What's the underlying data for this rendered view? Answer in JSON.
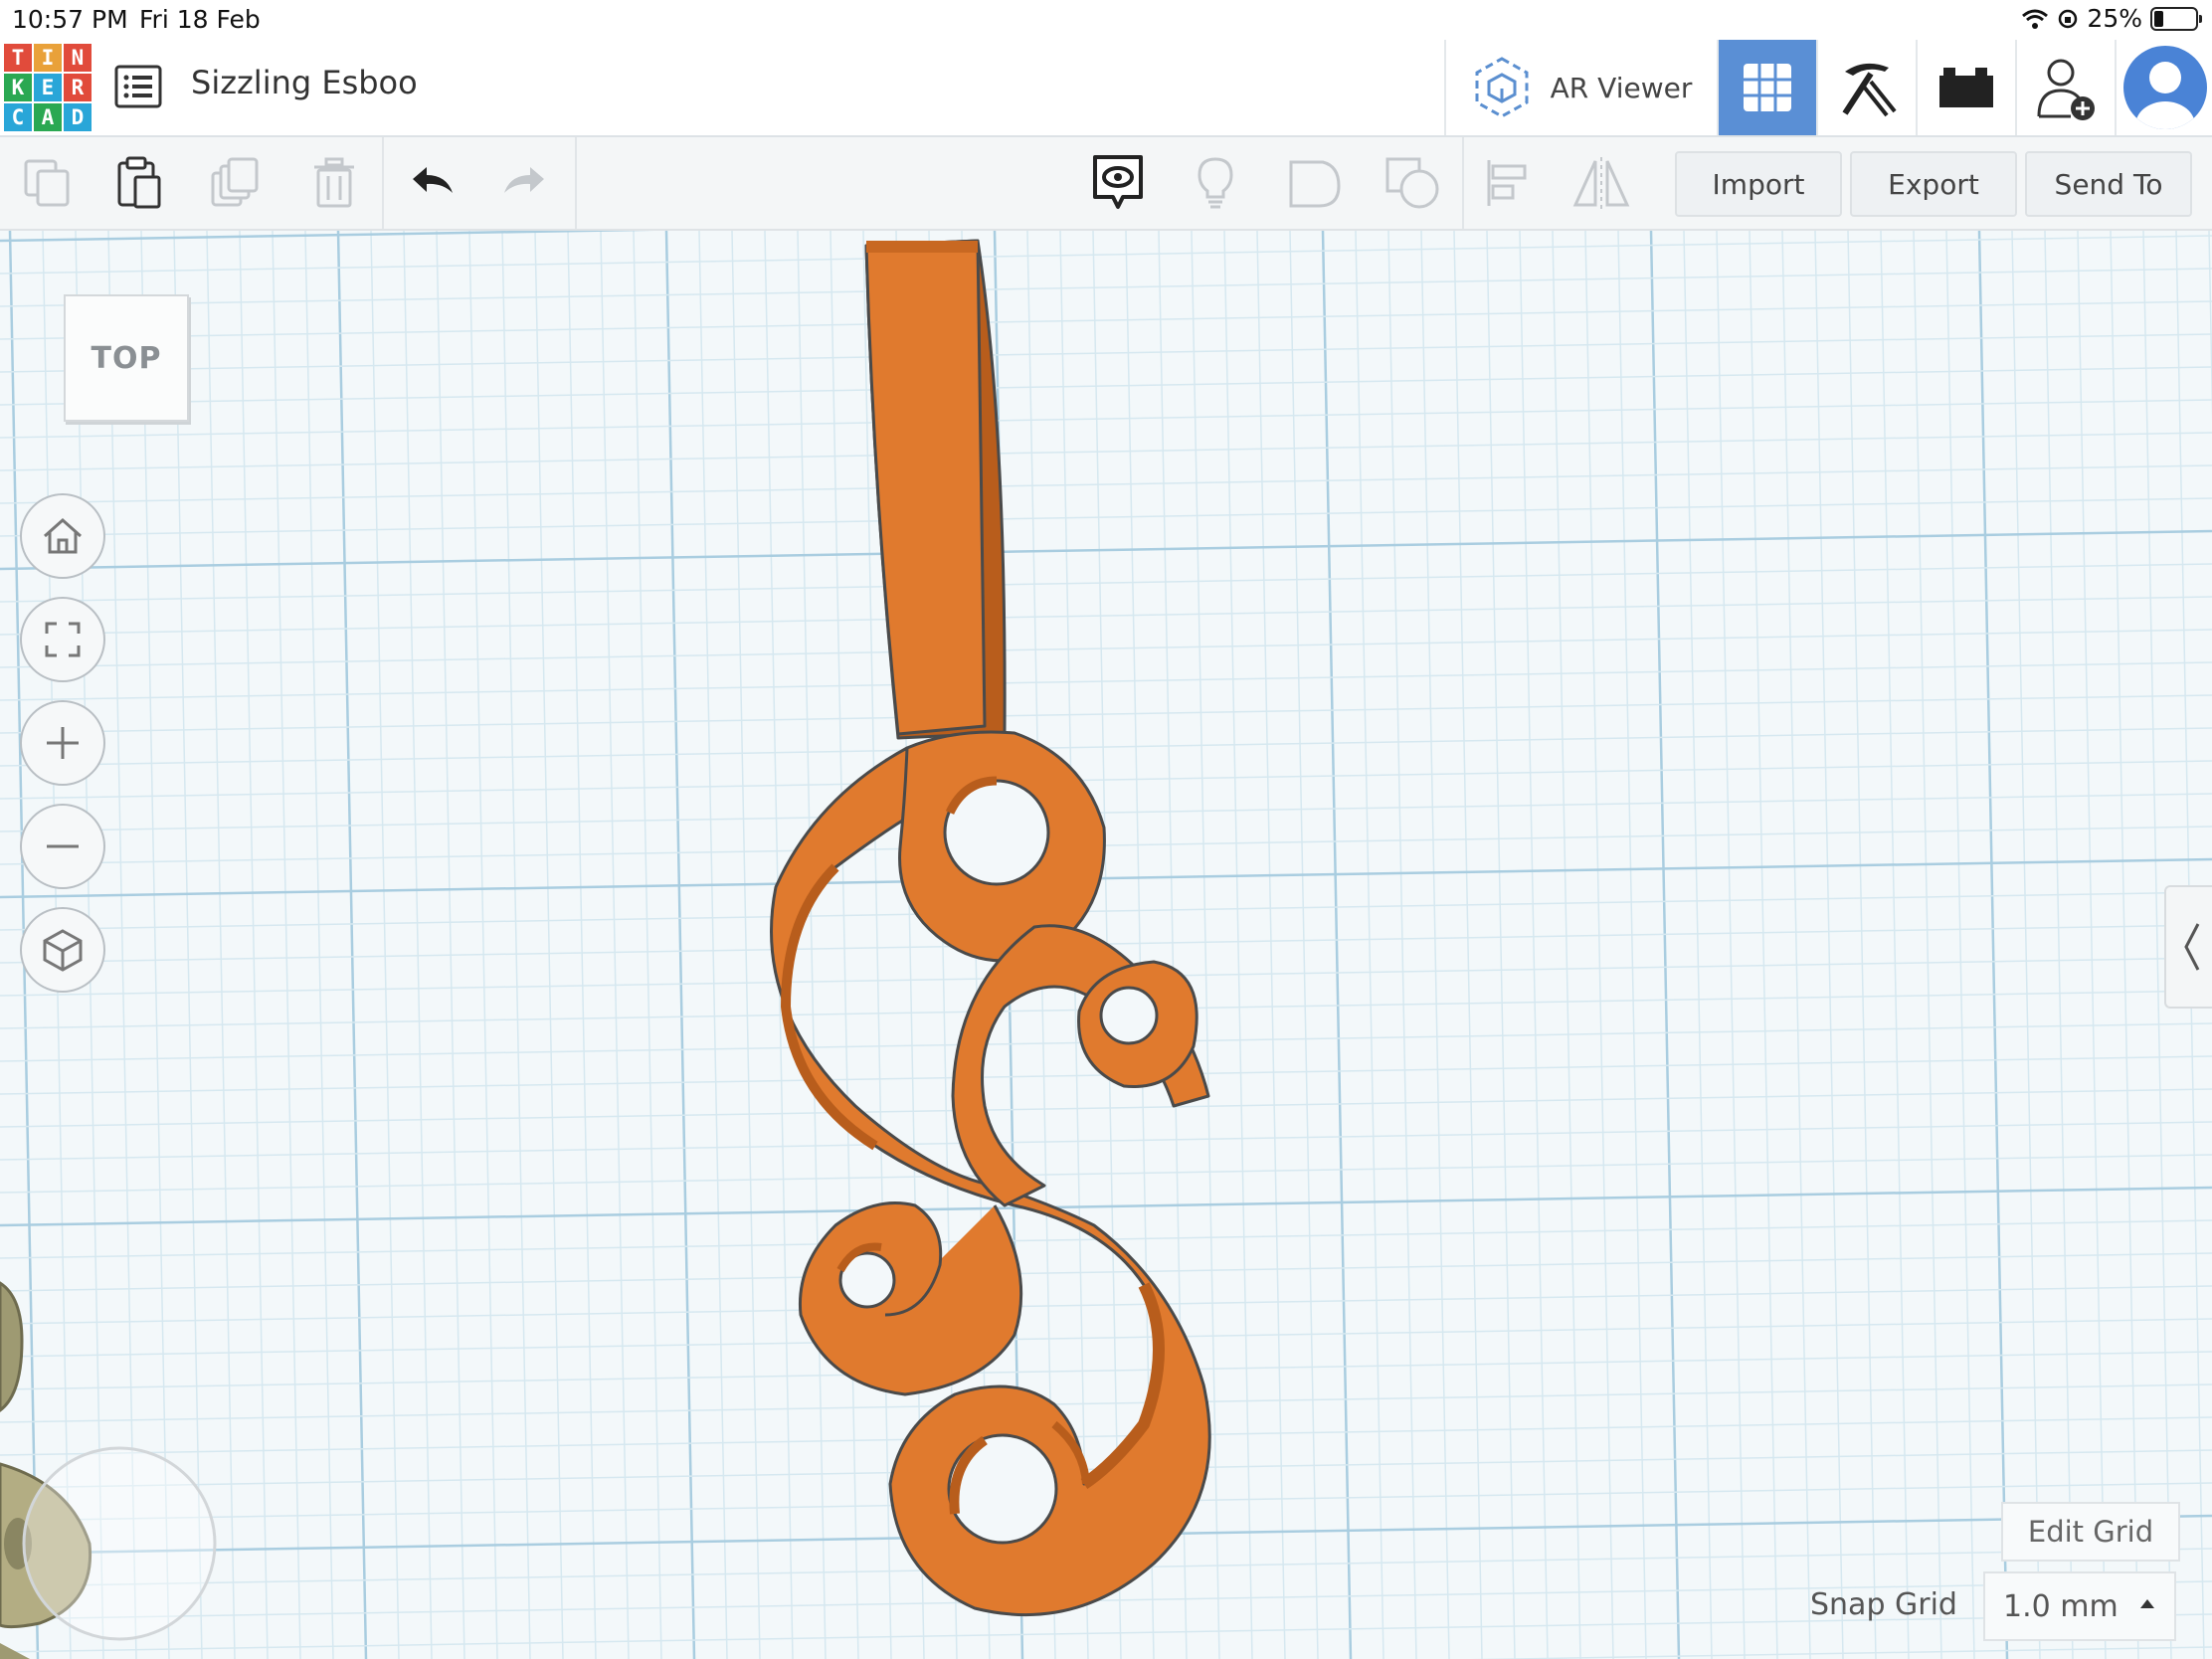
{
  "status_bar": {
    "time": "10:57 PM",
    "date": "Fri 18 Feb",
    "battery": "25%",
    "battery_level": 0.25
  },
  "app": {
    "logo_letters": [
      "T",
      "I",
      "N",
      "K",
      "E",
      "R",
      "C",
      "A",
      "D"
    ],
    "design_title": "Sizzling Esboo"
  },
  "header": {
    "ar_viewer_label": "AR Viewer",
    "active_view": "3D design",
    "icons": [
      "ar-viewer-icon",
      "grid-view-icon",
      "pickaxe-icon",
      "bricks-icon",
      "add-user-icon",
      "avatar-icon"
    ]
  },
  "toolbar": {
    "import_label": "Import",
    "export_label": "Export",
    "send_to_label": "Send To",
    "icons": [
      "copy-icon",
      "paste-icon",
      "duplicate-icon",
      "delete-icon",
      "undo-icon",
      "redo-icon",
      "notes-icon",
      "light-icon",
      "group-icon",
      "ungroup-icon",
      "align-icon",
      "mirror-icon"
    ]
  },
  "workplane": {
    "view_cube_label": "TOP",
    "edit_grid_label": "Edit Grid",
    "snap_grid_label": "Snap Grid",
    "snap_grid_value": "1.0 mm",
    "colors": {
      "shape": "#e07a2e",
      "shape_side": "#b85d1c",
      "grid_major": "#a9cde0",
      "grid_minor": "#d6e8f0"
    }
  }
}
